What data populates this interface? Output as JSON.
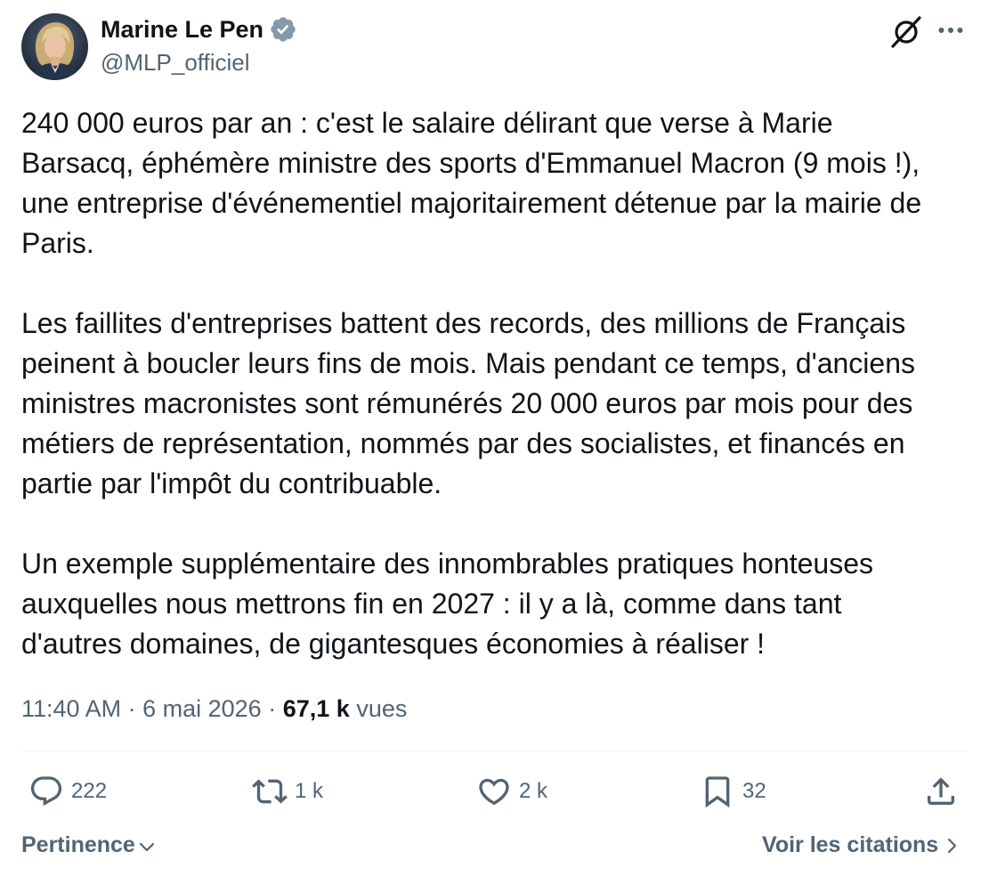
{
  "author": {
    "name": "Marine Le Pen",
    "handle": "@MLP_officiel",
    "verified": true,
    "avatar_icon": "avatar-photo",
    "badge_icon": "verified-badge-icon"
  },
  "header_icons": {
    "grok": "grok-icon",
    "more": "more-icon"
  },
  "tweet": {
    "paragraphs": [
      {
        "lines": [
          "240 000 euros par an : c'est le salaire délirant que verse à Marie",
          "Barsacq, éphémère ministre des sports d'Emmanuel Macron (9 mois !),",
          "une entreprise d'événementiel majoritairement détenue par la mairie de",
          "Paris."
        ]
      },
      {
        "lines": [
          "Les faillites d'entreprises battent des records, des millions de Français",
          "peinent à boucler leurs fins de mois. Mais pendant ce temps, d'anciens",
          "ministres macronistes sont rémunérés 20 000 euros par mois pour des",
          "métiers de représentation, nommés par des socialistes, et financés en",
          "partie par l'impôt du contribuable."
        ]
      },
      {
        "lines": [
          "Un exemple supplémentaire des innombrables pratiques honteuses",
          "auxquelles nous mettrons fin en 2027 : il y a là, comme dans tant",
          "d'autres domaines, de gigantesques économies à réaliser !"
        ]
      }
    ]
  },
  "meta": {
    "time": "11:40 AM",
    "separator": "·",
    "date": "6 mai 2026",
    "views_count": "67,1 k",
    "views_label": "vues"
  },
  "actions": {
    "reply": {
      "icon": "reply-icon",
      "count": "222"
    },
    "repost": {
      "icon": "repost-icon",
      "count": "1 k"
    },
    "like": {
      "icon": "like-icon",
      "count": "2 k"
    },
    "bookmark": {
      "icon": "bookmark-icon",
      "count": "32"
    },
    "share": {
      "icon": "share-icon"
    }
  },
  "footer": {
    "sort_label": "Pertinence",
    "sort_icon": "chevron-down-icon",
    "quotes_label": "Voir les citations",
    "quotes_icon": "chevron-right-icon"
  },
  "colors": {
    "text": "#0f1419",
    "secondary": "#536471",
    "divider": "#eff3f4",
    "verified_badge": "#829aab",
    "background": "#ffffff"
  }
}
